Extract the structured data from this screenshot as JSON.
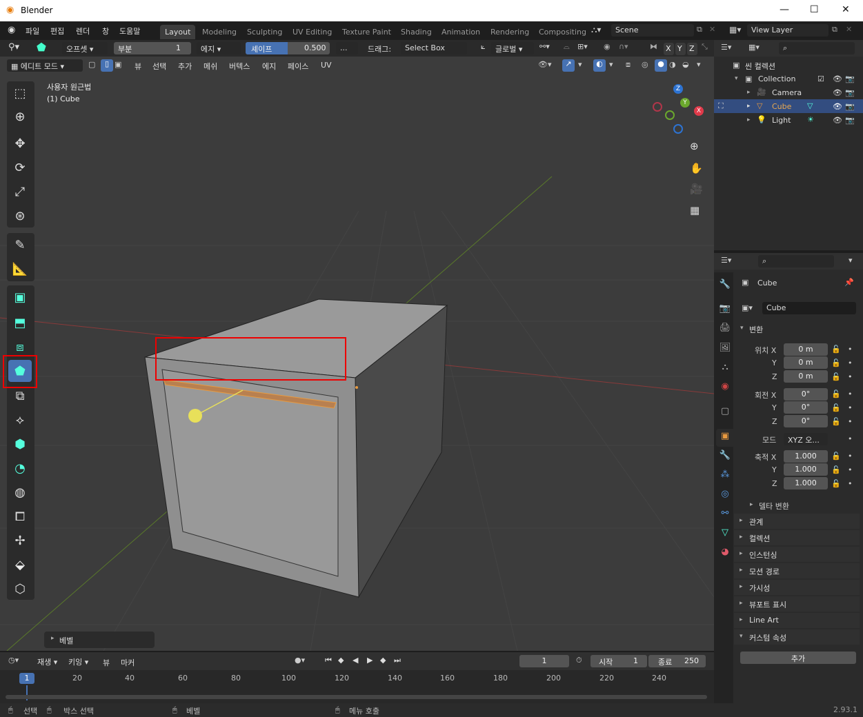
{
  "title": "Blender",
  "menus": [
    "파일",
    "편집",
    "렌더",
    "창",
    "도움말"
  ],
  "tabs": [
    "Layout",
    "Modeling",
    "Sculpting",
    "UV Editing",
    "Texture Paint",
    "Shading",
    "Animation",
    "Rendering",
    "Compositing"
  ],
  "scene": "Scene",
  "view_layer": "View Layer",
  "tool_settings": {
    "offset_label": "오프셋",
    "segments_label": "부분",
    "segments_value": "1",
    "edge_label": "에지",
    "shape_label": "셰이프",
    "shape_value": "0.500",
    "more": "...",
    "drag_label": "드래그:",
    "drag_value": "Select Box",
    "orientation": "글로벌"
  },
  "axes": [
    "X",
    "Y",
    "Z"
  ],
  "viewport_header": {
    "mode": "에디트 모드",
    "menus": [
      "뷰",
      "선택",
      "추가",
      "메쉬",
      "버텍스",
      "에지",
      "페이스",
      "UV"
    ]
  },
  "viewport": {
    "view_name": "사용자 원근법",
    "object_name": "(1) Cube",
    "operator_panel": "베벨",
    "gizmo_labels": [
      "Z",
      "Y",
      "X"
    ]
  },
  "outliner": {
    "root": "씬 컬렉션",
    "items": [
      {
        "label": "Collection"
      },
      {
        "label": "Camera"
      },
      {
        "label": "Cube"
      },
      {
        "label": "Light"
      }
    ]
  },
  "properties": {
    "object_name": "Cube",
    "data_name": "Cube",
    "section_transform": "변환",
    "location_label": "위치",
    "rotation_label": "회전",
    "scale_label": "축적",
    "x": "X",
    "y": "Y",
    "z": "Z",
    "loc": [
      "0 m",
      "0 m",
      "0 m"
    ],
    "rot": [
      "0°",
      "0°",
      "0°"
    ],
    "mode_label": "모드",
    "mode_value": "XYZ 오...",
    "scale": [
      "1.000",
      "1.000",
      "1.000"
    ],
    "delta": "델타 변환",
    "sections": [
      "관계",
      "컬렉션",
      "인스턴싱",
      "모션 경로",
      "가시성",
      "뷰포트 표시",
      "Line Art",
      "커스텀 속성"
    ],
    "add": "추가"
  },
  "timeline": {
    "playback": "재생",
    "keying": "키잉",
    "view": "뷰",
    "marker": "마커",
    "current_frame": "1",
    "start_label": "시작",
    "start": "1",
    "end_label": "종료",
    "end": "250",
    "ticks": [
      "1",
      "20",
      "40",
      "60",
      "80",
      "100",
      "120",
      "140",
      "160",
      "180",
      "200",
      "220",
      "240"
    ]
  },
  "status": {
    "select": "선택",
    "box_select": "박스 선택",
    "bevel": "베벨",
    "menu": "메뉴 호출",
    "version": "2.93.1"
  }
}
